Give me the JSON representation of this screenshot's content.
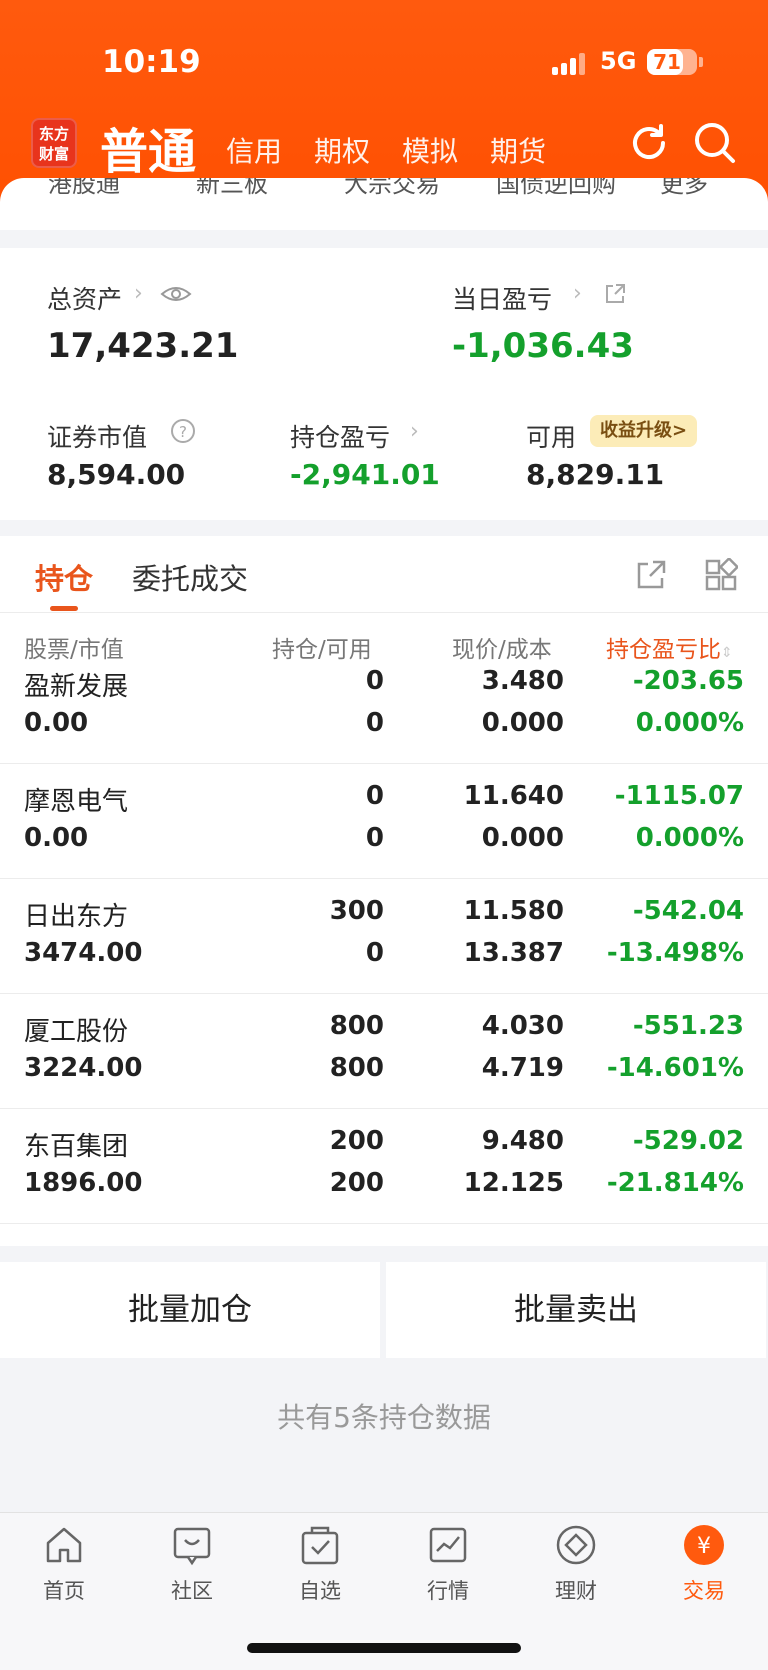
{
  "status_bar": {
    "time": "10:19",
    "network": "5G",
    "battery": "71"
  },
  "header": {
    "logo_text": "东方\n财富",
    "active_tab": "普通",
    "tabs": [
      "信用",
      "期权",
      "模拟",
      "期货"
    ],
    "peek_items": [
      "港股通",
      "新三板",
      "大宗交易",
      "国债逆回购",
      "更多"
    ]
  },
  "summary": {
    "total_assets_label": "总资产",
    "total_assets": "17,423.21",
    "daily_pnl_label": "当日盈亏",
    "daily_pnl": "-1,036.43",
    "market_value_label": "证券市值",
    "market_value": "8,594.00",
    "position_pnl_label": "持仓盈亏",
    "position_pnl": "-2,941.01",
    "available_label": "可用",
    "available": "8,829.11",
    "upgrade_badge": "收益升级>"
  },
  "holdings": {
    "tabs": [
      "持仓",
      "委托成交"
    ],
    "headers": {
      "stock": "股票",
      "market_value": "市值",
      "position": "持仓",
      "available": "可用",
      "price": "现价",
      "cost": "成本",
      "pnl_ratio": "持仓盈亏比"
    },
    "rows": [
      {
        "name": "盈新发展",
        "market_value": "0.00",
        "position": "0",
        "available": "0",
        "price": "3.480",
        "cost": "0.000",
        "pnl": "-203.65",
        "pnl_pct": "0.000%"
      },
      {
        "name": "摩恩电气",
        "market_value": "0.00",
        "position": "0",
        "available": "0",
        "price": "11.640",
        "cost": "0.000",
        "pnl": "-1115.07",
        "pnl_pct": "0.000%"
      },
      {
        "name": "日出东方",
        "market_value": "3474.00",
        "position": "300",
        "available": "0",
        "price": "11.580",
        "cost": "13.387",
        "pnl": "-542.04",
        "pnl_pct": "-13.498%"
      },
      {
        "name": "厦工股份",
        "market_value": "3224.00",
        "position": "800",
        "available": "800",
        "price": "4.030",
        "cost": "4.719",
        "pnl": "-551.23",
        "pnl_pct": "-14.601%"
      },
      {
        "name": "东百集团",
        "market_value": "1896.00",
        "position": "200",
        "available": "200",
        "price": "9.480",
        "cost": "12.125",
        "pnl": "-529.02",
        "pnl_pct": "-21.814%"
      }
    ]
  },
  "actions": {
    "batch_add": "批量加仓",
    "batch_sell": "批量卖出"
  },
  "footer_note": "共有5条持仓数据",
  "bottom_nav": [
    "首页",
    "社区",
    "自选",
    "行情",
    "理财",
    "交易"
  ],
  "colors": {
    "brand": "#ff5a0e",
    "loss_green": "#14a02c",
    "accent": "#e9551c"
  }
}
